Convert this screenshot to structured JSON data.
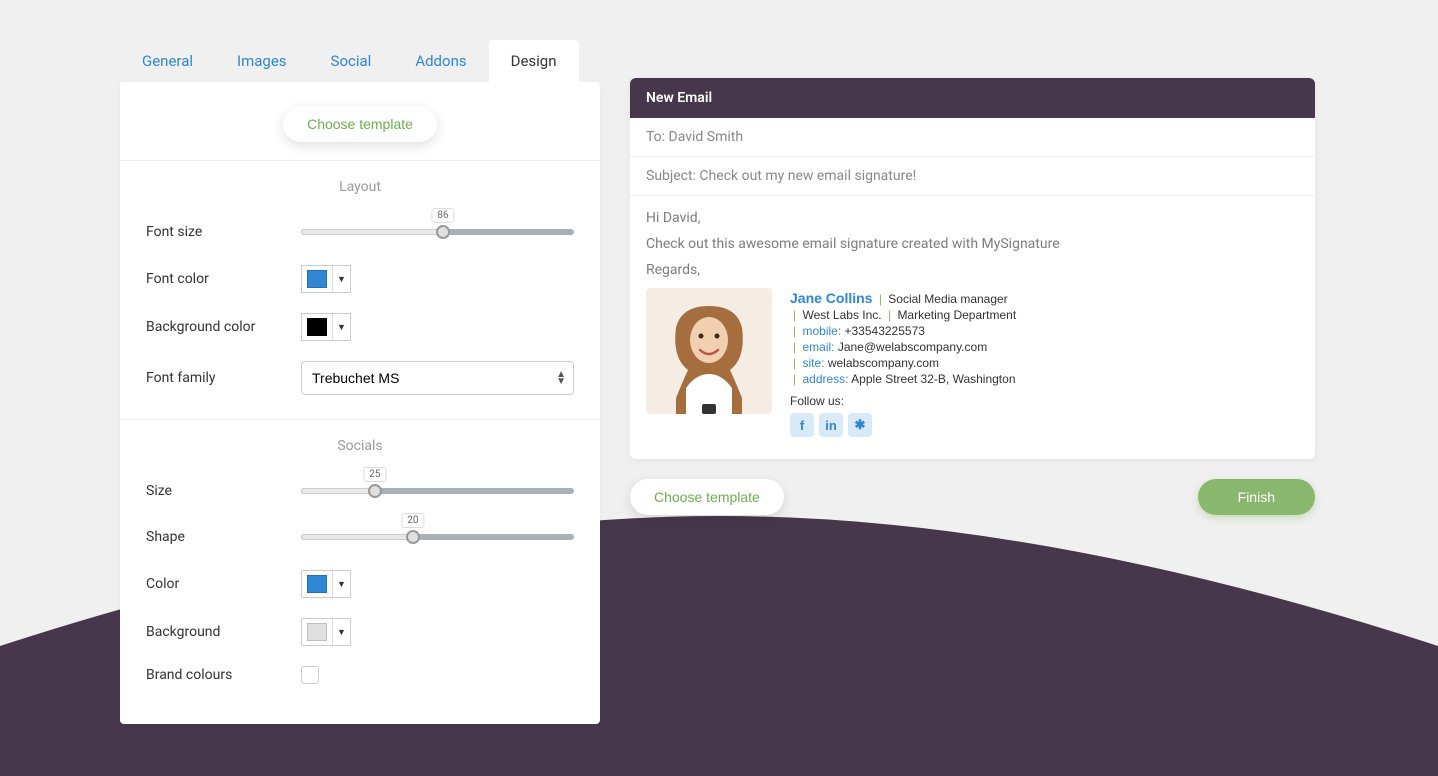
{
  "tabs": {
    "general": "General",
    "images": "Images",
    "social": "Social",
    "addons": "Addons",
    "design": "Design"
  },
  "buttons": {
    "choose_template": "Choose template",
    "finish": "Finish"
  },
  "sections": {
    "layout": "Layout",
    "socials": "Socials"
  },
  "layout": {
    "font_size_label": "Font size",
    "font_size_value": "86",
    "font_size_percent": 52,
    "font_color_label": "Font color",
    "font_color_value": "#2f87d4",
    "bg_color_label": "Background color",
    "bg_color_value": "#000000",
    "font_family_label": "Font family",
    "font_family_value": "Trebuchet MS"
  },
  "socials": {
    "size_label": "Size",
    "size_value": "25",
    "size_percent": 27,
    "shape_label": "Shape",
    "shape_value": "20",
    "shape_percent": 41,
    "color_label": "Color",
    "color_value": "#2f87d4",
    "bg_label": "Background",
    "bg_value": "#e0e0e0",
    "brand_label": "Brand colours"
  },
  "email": {
    "header": "New Email",
    "to": "To: David Smith",
    "subject": "Subject: Check out my new email signature!",
    "greeting": "Hi David,",
    "body": "Check out this awesome email signature created with MySignature",
    "regards": "Regards,"
  },
  "signature": {
    "name": "Jane Collins",
    "title": "Social Media manager",
    "company": "West Labs Inc.",
    "department": "Marketing Department",
    "mobile_key": "mobile:",
    "mobile_val": "+33543225573",
    "email_key": "email:",
    "email_val": "Jane@welabscompany.com",
    "site_key": "site:",
    "site_val": "welabscompany.com",
    "address_key": "address:",
    "address_val": "Apple Street 32-B, Washington",
    "follow": "Follow us:"
  }
}
